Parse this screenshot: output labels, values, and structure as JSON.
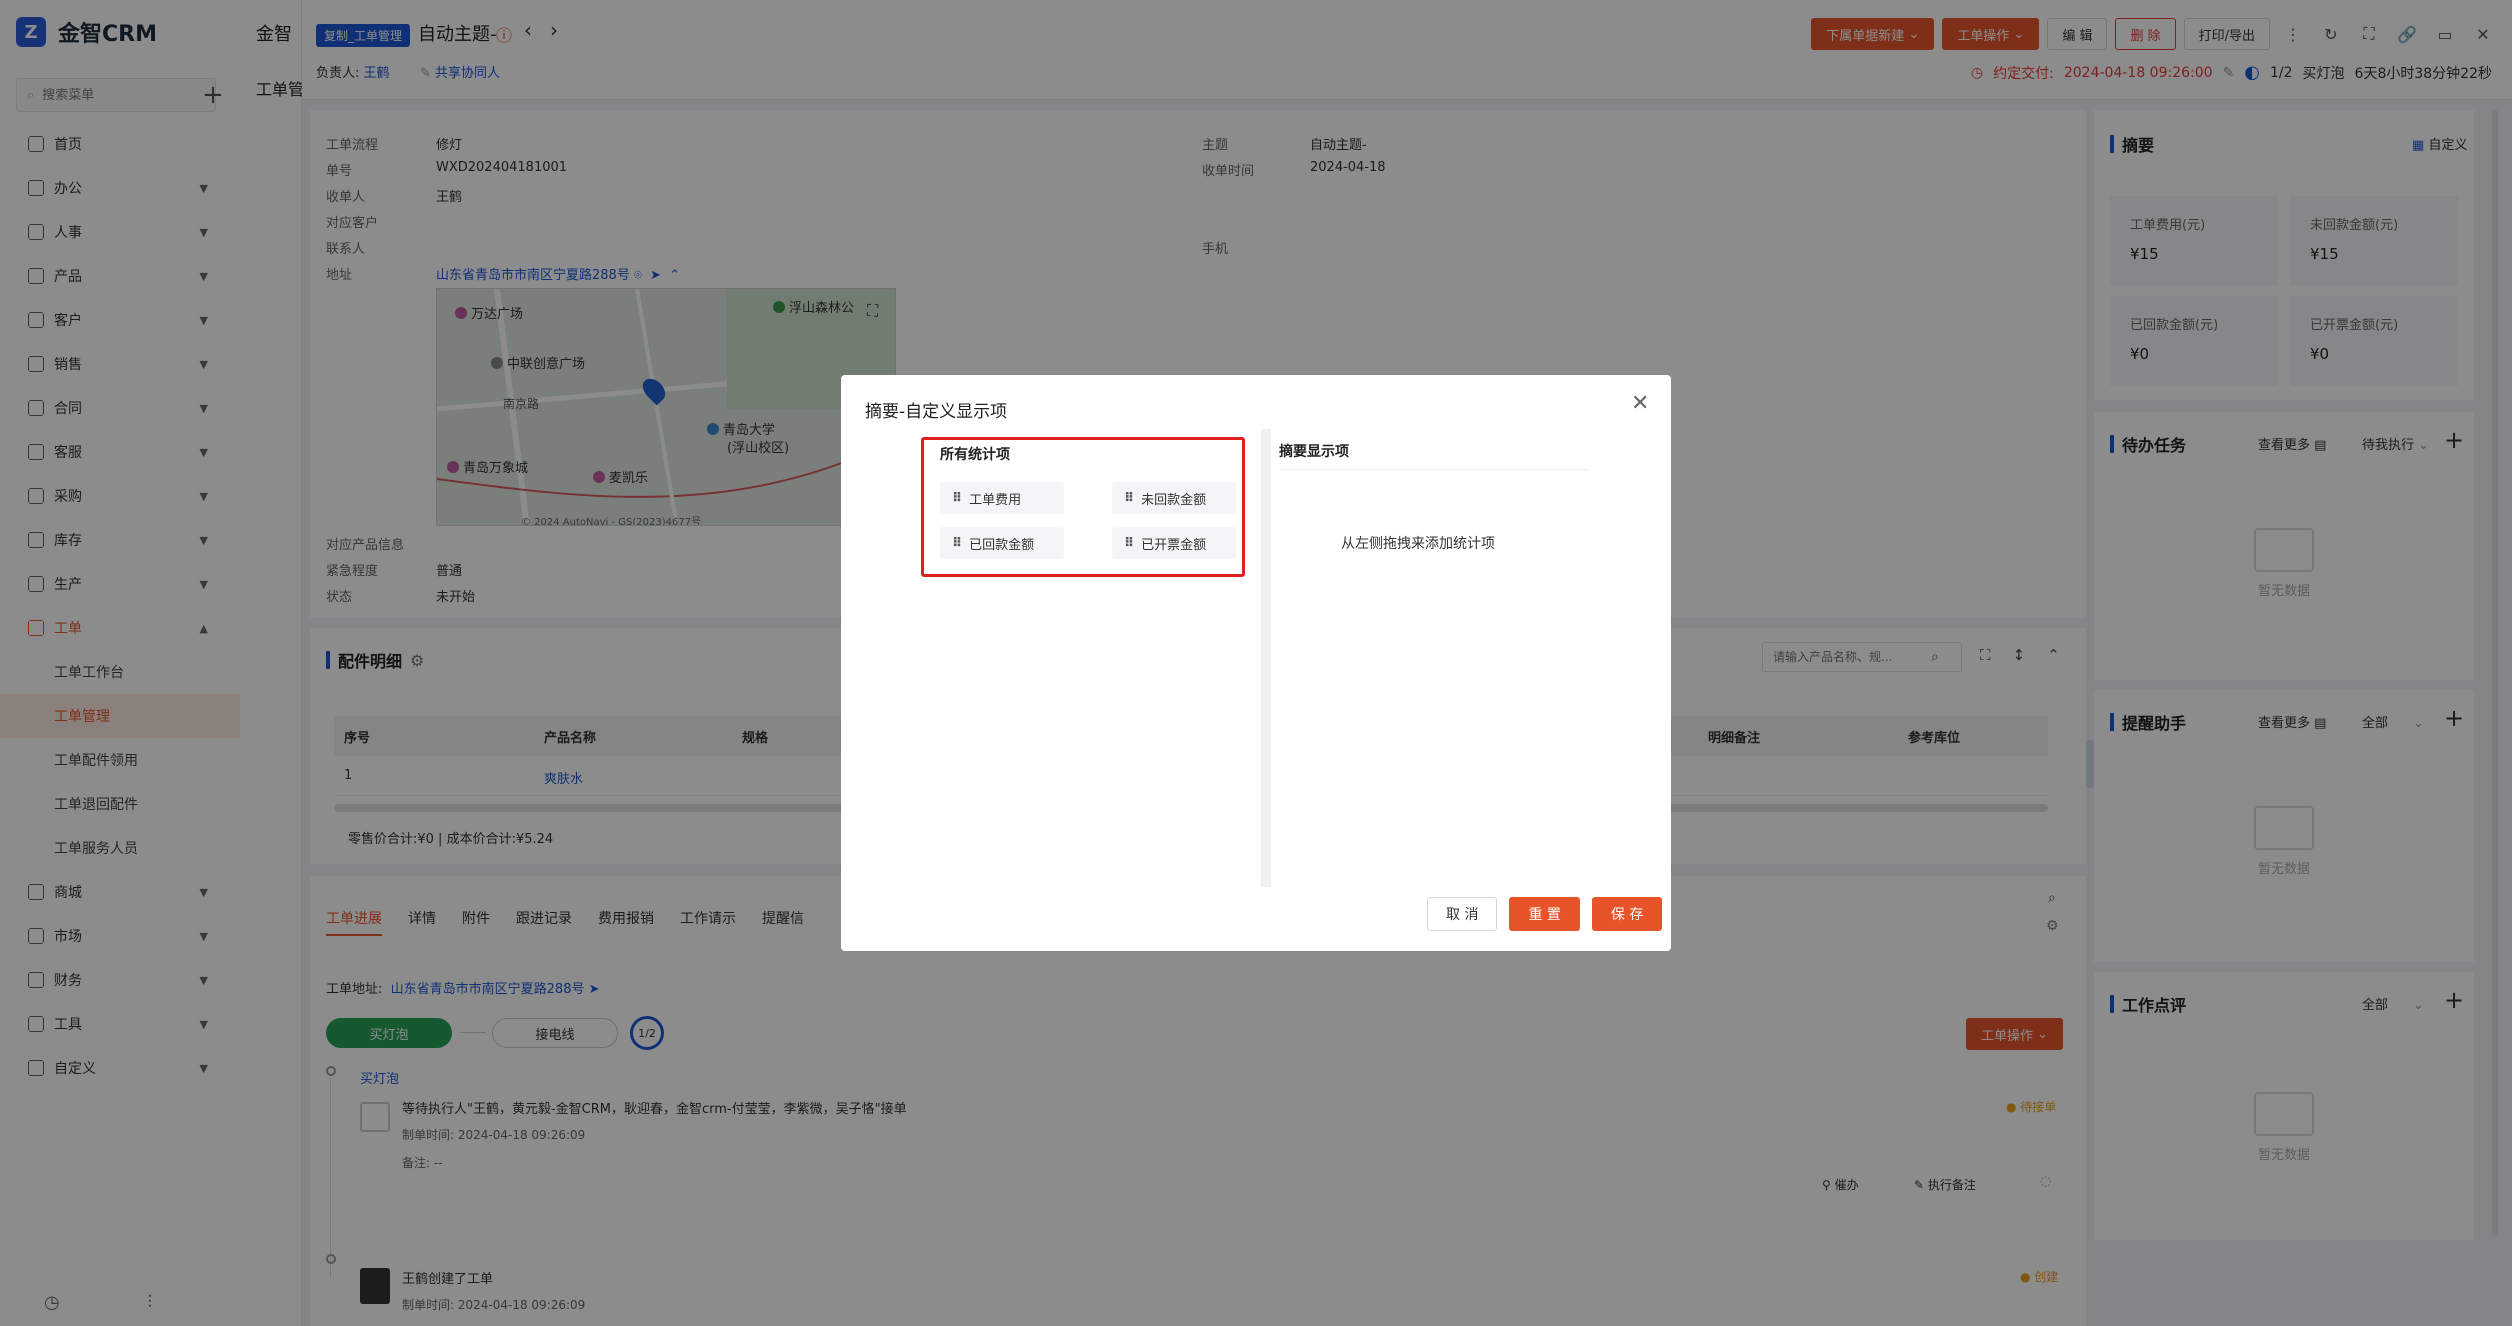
{
  "app": {
    "name": "金智CRM",
    "breadcrumb": "金智",
    "page_title": "工单管理"
  },
  "sidebar": {
    "search_placeholder": "搜索菜单",
    "items": [
      {
        "label": "首页",
        "expandable": false
      },
      {
        "label": "办公",
        "expandable": true
      },
      {
        "label": "人事",
        "expandable": true
      },
      {
        "label": "产品",
        "expandable": true
      },
      {
        "label": "客户",
        "expandable": true
      },
      {
        "label": "销售",
        "expandable": true
      },
      {
        "label": "合同",
        "expandable": true
      },
      {
        "label": "客服",
        "expandable": true
      },
      {
        "label": "采购",
        "expandable": true
      },
      {
        "label": "库存",
        "expandable": true
      },
      {
        "label": "生产",
        "expandable": true
      },
      {
        "label": "工单",
        "expandable": true,
        "active": true
      }
    ],
    "sub_items": [
      "工单工作台",
      "工单管理",
      "工单配件领用",
      "工单退回配件",
      "工单服务人员"
    ],
    "selected_sub": "工单管理",
    "items_after": [
      "商城",
      "市场",
      "财务",
      "工具",
      "自定义"
    ]
  },
  "header": {
    "tag": "复制_工单管理",
    "title": "自动主题-",
    "owner_label": "负责人:",
    "owner_name": "王鹤",
    "share_label": "共享协同人",
    "buttons": {
      "new_dropdown": "下属单据新建",
      "ops_dropdown": "工单操作",
      "edit": "编 辑",
      "delete": "删 除",
      "print": "打印/导出"
    },
    "due_label": "约定交付:",
    "due_time": "2024-04-18 09:26:00",
    "progress": "1/2",
    "stage": "买灯泡",
    "remaining": "6天8小时38分钟22秒"
  },
  "detail": {
    "fields": [
      {
        "label": "工单流程",
        "value": "修灯"
      },
      {
        "label": "单号",
        "value": "WXD202404181001"
      },
      {
        "label": "收单人",
        "value": "王鹤"
      },
      {
        "label": "对应客户",
        "value": ""
      },
      {
        "label": "联系人",
        "value": ""
      },
      {
        "label": "地址",
        "value": "山东省青岛市市南区宁夏路288号"
      }
    ],
    "right_fields": [
      {
        "label": "主题",
        "value": "自动主题-"
      },
      {
        "label": "收单时间",
        "value": "2024-04-18"
      },
      {
        "label": "手机",
        "value": ""
      }
    ],
    "fields_after_map": [
      {
        "label": "对应产品信息",
        "value": ""
      },
      {
        "label": "紧急程度",
        "value": "普通"
      },
      {
        "label": "状态",
        "value": "未开始"
      }
    ],
    "map_labels": [
      "万达广场",
      "浮山森林公",
      "中联创意广场",
      "青岛大学",
      "(浮山校区)",
      "南京路",
      "青岛万象城",
      "麦凯乐",
      "© 2024 AutoNavi - GS(2023)4677号"
    ]
  },
  "parts": {
    "title": "配件明细",
    "search_placeholder": "请输入产品名称、规...",
    "columns": [
      "序号",
      "产品名称",
      "规格",
      "明细备注",
      "参考库位"
    ],
    "rows": [
      {
        "no": "1",
        "name": "爽肤水"
      }
    ],
    "summary": "零售价合计:¥0 |   成本价合计:¥5.24"
  },
  "tabs": [
    "工单进展",
    "详情",
    "附件",
    "跟进记录",
    "费用报销",
    "工作请示",
    "提醒信"
  ],
  "progress": {
    "address_label": "工单地址:",
    "address": "山东省青岛市市南区宁夏路288号",
    "steps": [
      "买灯泡",
      "接电线"
    ],
    "step_count": "1/2",
    "ops_button": "工单操作",
    "timeline": [
      {
        "title": "买灯泡",
        "text": "等待执行人\"王鹤，黄元毅-金智CRM，耿迎春，金智crm-付莹莹，李紫微，吴子恪\"接单",
        "time": "制单时间:  2024-04-18 09:26:09",
        "note": "备注:  --",
        "status": "待接单",
        "actions": [
          "催办",
          "执行备注"
        ]
      },
      {
        "title": "王鹤创建了工单",
        "time": "制单时间:  2024-04-18 09:26:09",
        "status": "创建"
      }
    ]
  },
  "right": {
    "summary": {
      "title": "摘要",
      "custom": "自定义",
      "stats": [
        {
          "label": "工单费用(元)",
          "value": "¥15"
        },
        {
          "label": "未回款金额(元)",
          "value": "¥15"
        },
        {
          "label": "已回款金额(元)",
          "value": "¥0"
        },
        {
          "label": "已开票金额(元)",
          "value": "¥0"
        }
      ]
    },
    "tasks": {
      "title": "待办任务",
      "more": "查看更多",
      "filter": "待我执行",
      "empty": "暂无数据"
    },
    "reminders": {
      "title": "提醒助手",
      "more": "查看更多",
      "filter": "全部",
      "empty": "暂无数据"
    },
    "reviews": {
      "title": "工作点评",
      "filter": "全部",
      "empty": "暂无数据"
    }
  },
  "modal": {
    "title": "摘要-自定义显示项",
    "left_title": "所有统计项",
    "chips": [
      "工单费用",
      "未回款金额",
      "已回款金额",
      "已开票金额"
    ],
    "right_title": "摘要显示项",
    "hint": "从左侧拖拽来添加统计项",
    "cancel": "取 消",
    "reset": "重 置",
    "save": "保 存"
  }
}
